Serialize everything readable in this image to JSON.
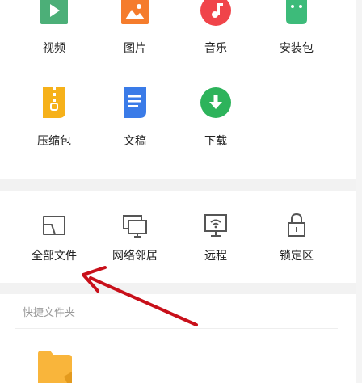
{
  "categories": [
    {
      "label": "视频",
      "icon": "video-icon",
      "color": "#4CAF78"
    },
    {
      "label": "图片",
      "icon": "image-icon",
      "color": "#F57C2C"
    },
    {
      "label": "音乐",
      "icon": "music-icon",
      "color": "#F0444A"
    },
    {
      "label": "安装包",
      "icon": "android-icon",
      "color": "#3DBB7A"
    },
    {
      "label": "压缩包",
      "icon": "zip-icon",
      "color": "#F6B11A"
    },
    {
      "label": "文稿",
      "icon": "document-icon",
      "color": "#3A7BE8"
    },
    {
      "label": "下载",
      "icon": "download-icon",
      "color": "#2DB35B"
    }
  ],
  "tools": [
    {
      "label": "全部文件",
      "icon": "all-files-icon"
    },
    {
      "label": "网络邻居",
      "icon": "network-neighbors-icon"
    },
    {
      "label": "远程",
      "icon": "remote-icon"
    },
    {
      "label": "锁定区",
      "icon": "lock-zone-icon"
    }
  ],
  "quick_folders": {
    "title": "快捷文件夹",
    "items": [
      {
        "icon": "folder-icon",
        "color": "#F9B53B"
      }
    ]
  },
  "annotation": {
    "icon": "red-arrow-icon",
    "color": "#C8101A"
  }
}
